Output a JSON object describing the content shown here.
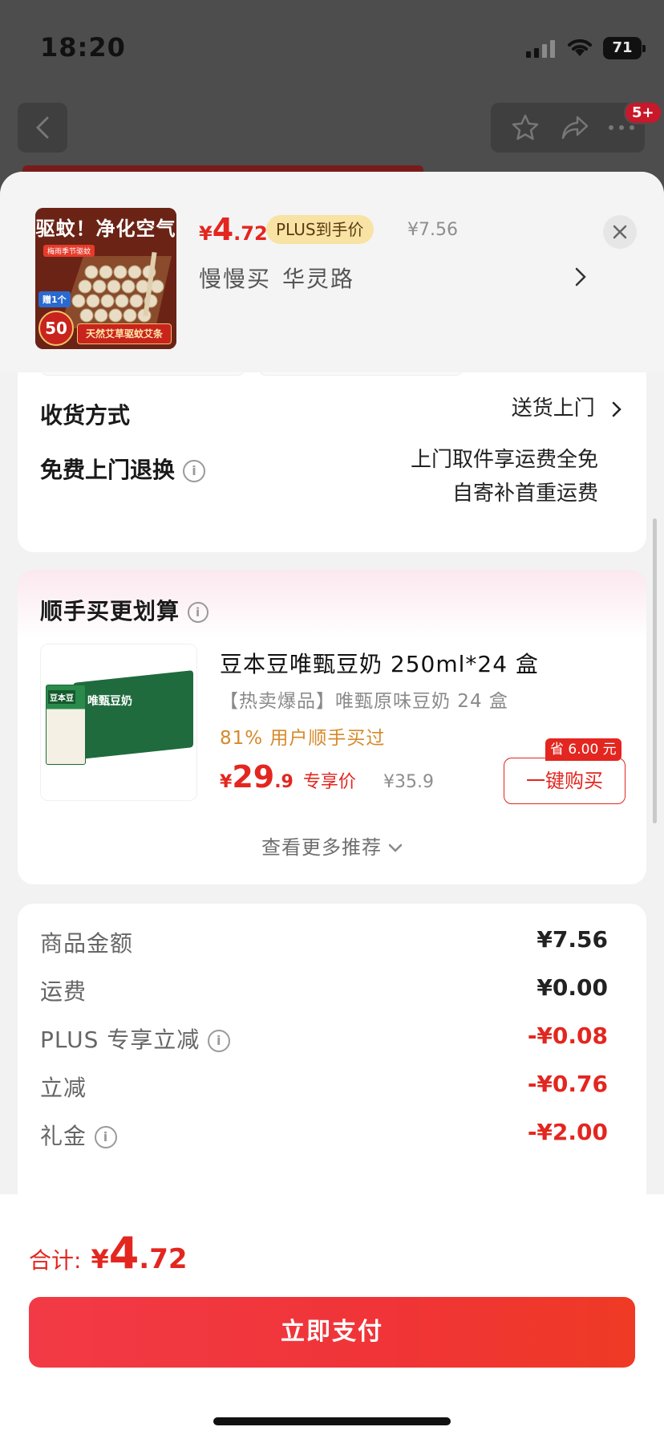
{
  "status_bar": {
    "time": "18:20",
    "battery": "71"
  },
  "background": {
    "cart_badge": "5+"
  },
  "product": {
    "thumb_title": "驱蚊！净化空气",
    "thumb_sub": "梅雨季节驱蚊",
    "thumb_gift": "赠1个",
    "thumb_banner": "天然艾草驱蚊艾条",
    "thumb_count": "50",
    "price_symbol": "¥",
    "price_int": "4",
    "price_dec": ".72",
    "plus_tag": "PLUS到手价",
    "original_price": "¥7.56",
    "shop": "慢慢买",
    "address": "华灵路"
  },
  "delivery": {
    "method_label": "收货方式",
    "method_value": "送货上门",
    "return_label": "免费上门退换",
    "return_value_1": "上门取件享运费全免",
    "return_value_2": "自寄补首重运费"
  },
  "recommend": {
    "title": "顺手买更划算",
    "name": "豆本豆唯甄豆奶 250ml*24 盒",
    "desc": "【热卖爆品】唯甄原味豆奶 24 盒",
    "buyers": "81% 用户顺手买过",
    "price_symbol": "¥",
    "price_int": "29",
    "price_dec": ".9",
    "price_label": "专享价",
    "original_price": "¥35.9",
    "save_badge": "省 6.00 元",
    "buy_button": "一键购买",
    "more": "查看更多推荐",
    "box_brand": "豆本豆",
    "box_label": "唯甄豆奶"
  },
  "summary": {
    "rows": [
      {
        "label": "商品金额",
        "value": "¥7.56",
        "info": false,
        "negative": false
      },
      {
        "label": "运费",
        "value": "¥0.00",
        "info": false,
        "negative": false
      },
      {
        "label": "PLUS 专享立减",
        "value": "-¥0.08",
        "info": true,
        "negative": true
      },
      {
        "label": "立减",
        "value": "-¥0.76",
        "info": false,
        "negative": true
      },
      {
        "label": "礼金",
        "value": "-¥2.00",
        "info": true,
        "negative": true
      }
    ]
  },
  "footer": {
    "total_label": "合计:",
    "total_symbol": "¥",
    "total_int": "4",
    "total_dec": ".72",
    "pay_button": "立即支付"
  },
  "colors": {
    "accent": "#e3261f",
    "plus_tag_bg": "#f8e3a4",
    "buyers_text": "#d58a2a"
  }
}
